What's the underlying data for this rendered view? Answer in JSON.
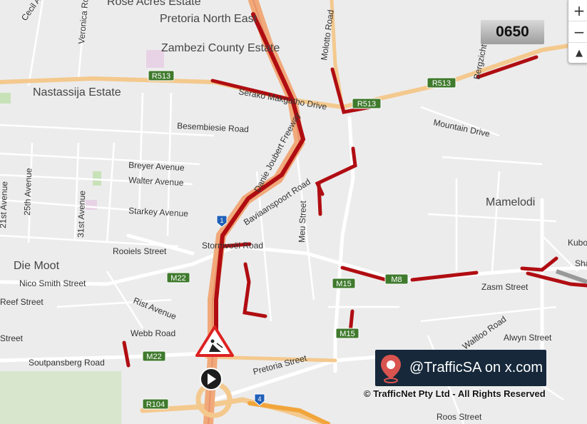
{
  "map": {
    "areas": [
      "Pretoria North East",
      "Zambezi County Estate",
      "Nastassija Estate",
      "Mamelodi",
      "Die Moot",
      "Rose Acres Estate"
    ],
    "streets": [
      "Cecil Avenue",
      "Veronica Road",
      "Molotto Road",
      "Bergzicht Road",
      "Mountain Drive",
      "Besembiesie Road",
      "Serako Makgatho Drive",
      "Breyer Avenue",
      "Walter Avenue",
      "Starkey Avenue",
      "25th Avenue",
      "31st Avenue",
      "21st Avenue",
      "Danie Joubert Freeway",
      "Baviaanspoort Road",
      "Meu Street",
      "Rooiels Street",
      "Stormvoël Road",
      "Nico Smith Street",
      "Reef Street",
      "Rist Avenue",
      "Webb Road",
      "Soutpansberg Road",
      "Pretoria Street",
      "Zasm Street",
      "Alwyn Street",
      "Waltloo Road",
      "Roos Street",
      "Kubo",
      "Sha",
      "Street"
    ],
    "routes": [
      "R513",
      "R513",
      "R513",
      "M22",
      "M22",
      "M15",
      "M15",
      "M8",
      "R104",
      "1",
      "4"
    ],
    "incident": "roadworks-icon",
    "colors": {
      "congestion": "#b00d12",
      "freeway": "#f1a97a",
      "major_road": "#f4c98e",
      "base": "#ececec",
      "caution": "#f1a53b"
    }
  },
  "time": "0650",
  "zoom": {
    "in": "+",
    "out": "−",
    "reset": "▲"
  },
  "social": {
    "handle": "@TrafficSA on x.com",
    "icon": "map-pin-icon"
  },
  "copyright": "© TrafficNet Pty Ltd - All Rights Reserved"
}
